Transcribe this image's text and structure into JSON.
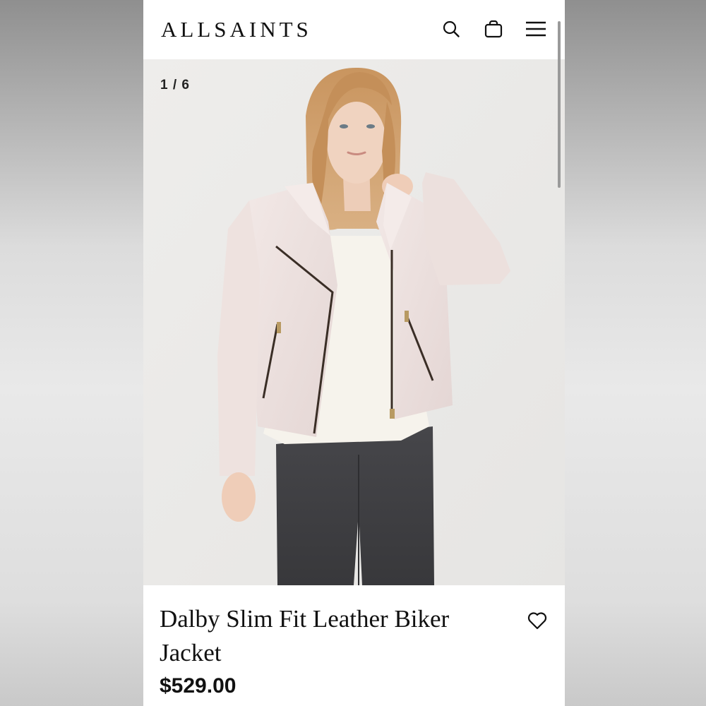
{
  "brand": {
    "logo_text": "ALLSAINTS"
  },
  "header": {
    "icons": {
      "search": "search-icon",
      "bag": "shopping-bag-icon",
      "menu": "hamburger-menu-icon"
    }
  },
  "gallery": {
    "counter": "1 / 6",
    "current_index": 1,
    "total_images": 6
  },
  "product": {
    "title": "Dalby Slim Fit Leather Biker Jacket",
    "price": "$529.00",
    "wishlist_icon": "heart-icon"
  },
  "colors": {
    "jacket": "#efe3e1",
    "background_photo": "#ecebe9",
    "jeans": "#3d3d40",
    "text": "#111111"
  }
}
